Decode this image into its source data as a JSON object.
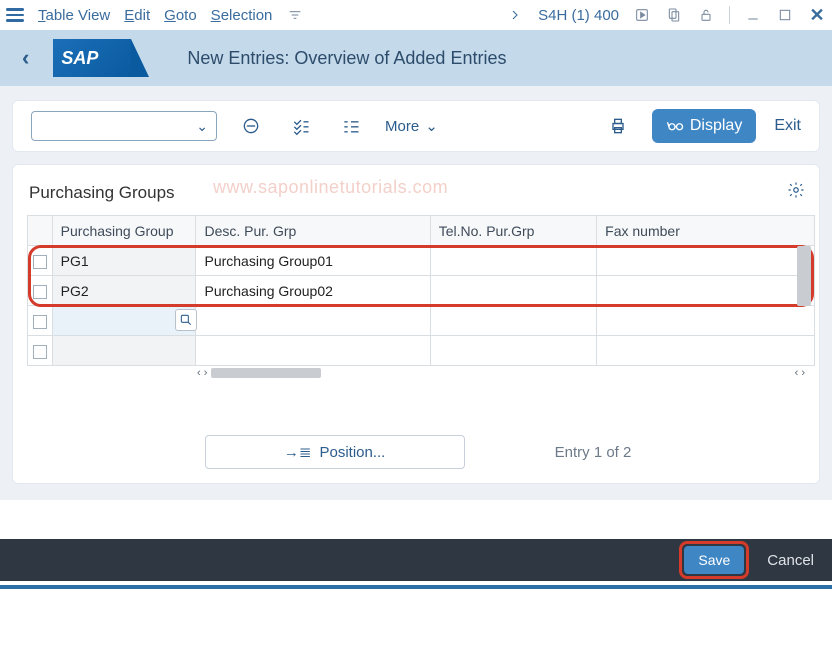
{
  "menu": {
    "items": [
      "Table View",
      "Edit",
      "Goto",
      "Selection"
    ],
    "system": "S4H (1) 400"
  },
  "header": {
    "logo_text": "SAP",
    "page_title": "New Entries: Overview of Added Entries"
  },
  "toolbar": {
    "more_label": "More",
    "display_label": "Display",
    "exit_label": "Exit"
  },
  "content": {
    "section_title": "Purchasing Groups",
    "watermark": "www.saponlinetutorials.com",
    "columns": {
      "purchasing_group": "Purchasing Group",
      "desc": "Desc. Pur. Grp",
      "tel": "Tel.No. Pur.Grp",
      "fax": "Fax number"
    },
    "rows": [
      {
        "pg": "PG1",
        "desc": "Purchasing Group01",
        "tel": "",
        "fax": ""
      },
      {
        "pg": "PG2",
        "desc": "Purchasing Group02",
        "tel": "",
        "fax": ""
      }
    ]
  },
  "position": {
    "button_label": "Position...",
    "entry_label": "Entry 1 of 2"
  },
  "footer": {
    "save_label": "Save",
    "cancel_label": "Cancel"
  }
}
